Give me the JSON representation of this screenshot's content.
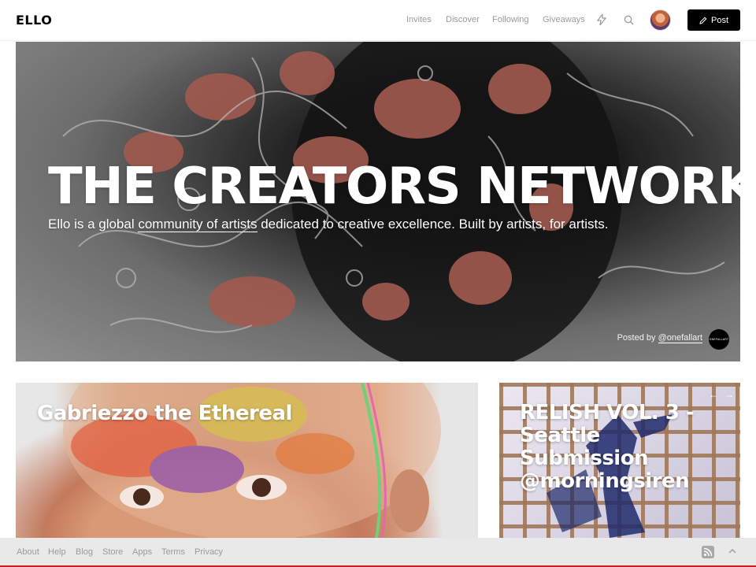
{
  "header": {
    "logo": "ELLO",
    "nav": [
      "Invites",
      "Discover",
      "Following",
      "Giveaways"
    ],
    "icons": [
      "lightning-icon",
      "search-icon"
    ],
    "post_label": "Post"
  },
  "hero": {
    "title": "THE CREATORS NETWORK",
    "subtitle_prefix": "Ello is a global ",
    "subtitle_link": "community of artists",
    "subtitle_suffix": " dedicated to creative excellence. Built by artists, for artists.",
    "posted_by_label": "Posted by",
    "posted_by_handle": "@onefallart",
    "posted_avatar_text": "ONEFALLART"
  },
  "cards": [
    {
      "title": "Gabriezzo the Ethereal"
    },
    {
      "title": "RELISH VOL. 3 - Seattle Submission @morningsiren",
      "prev": "←",
      "next": "→"
    }
  ],
  "footer": {
    "links": [
      "About",
      "Help",
      "Blog",
      "Store",
      "Apps",
      "Terms",
      "Privacy"
    ],
    "icons": [
      "rss-icon",
      "chevron-up-icon"
    ]
  },
  "colors": {
    "footer_accent": "#c62020",
    "button_bg": "#000000"
  }
}
